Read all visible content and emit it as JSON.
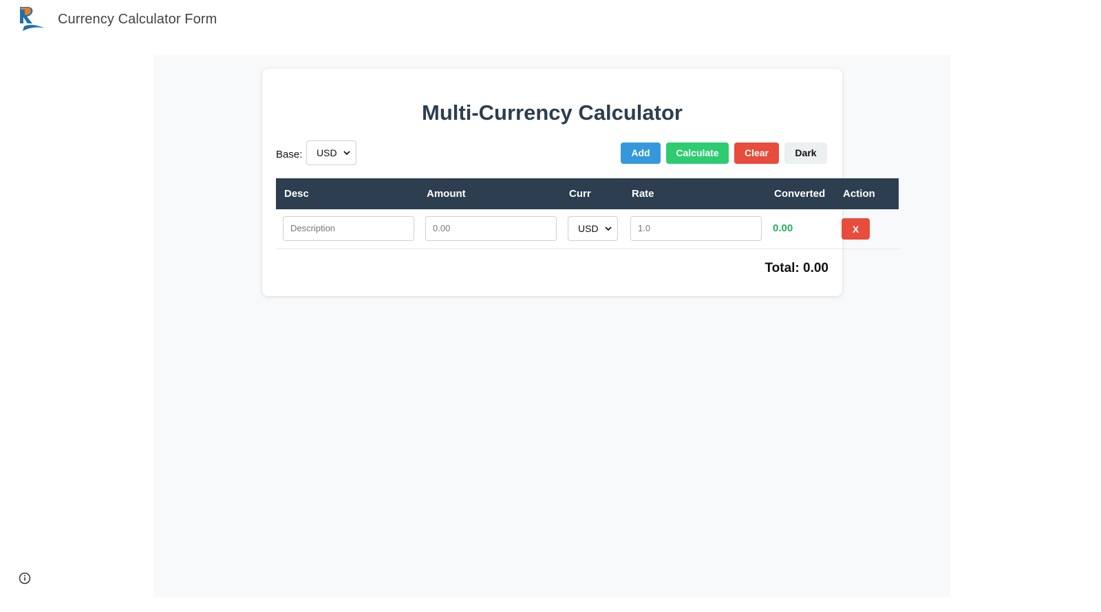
{
  "app": {
    "title": "Currency Calculator Form"
  },
  "card": {
    "title": "Multi-Currency Calculator",
    "base_label": "Base:",
    "base_value": "USD",
    "buttons": {
      "add": "Add",
      "calculate": "Calculate",
      "clear": "Clear",
      "dark": "Dark"
    },
    "table": {
      "headers": [
        "Desc",
        "Amount",
        "Curr",
        "Rate",
        "Converted",
        "Action"
      ],
      "rows": [
        {
          "desc_placeholder": "Description",
          "amount_placeholder": "0.00",
          "currency": "USD",
          "rate_value": "1.0",
          "converted": "0.00",
          "action": "X"
        }
      ]
    },
    "total": "Total: 0.00"
  },
  "colors": {
    "header_bg": "#2c3e50",
    "add": "#3498db",
    "calculate": "#2ecc71",
    "clear": "#e74c3c",
    "dark": "#ecf0f1",
    "converted": "#27ae60"
  },
  "icons": {
    "logo": "brand-logo-icon",
    "select_arrow": "chevron-down-icon",
    "info": "info-icon"
  }
}
